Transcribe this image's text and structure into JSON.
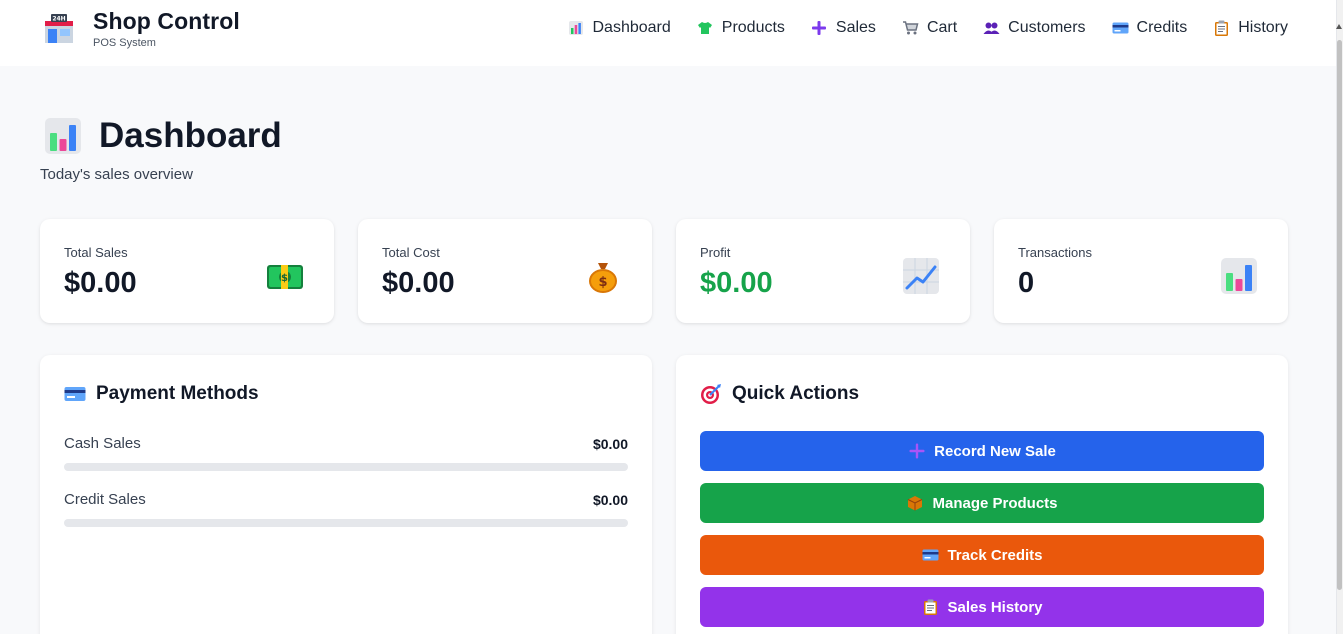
{
  "header": {
    "title": "Shop Control",
    "subtitle": "POS System",
    "logo_icon": "store-24h-icon",
    "nav": [
      {
        "label": "Dashboard",
        "icon": "bar-chart-icon"
      },
      {
        "label": "Products",
        "icon": "shirt-icon"
      },
      {
        "label": "Sales",
        "icon": "plus-icon"
      },
      {
        "label": "Cart",
        "icon": "cart-icon"
      },
      {
        "label": "Customers",
        "icon": "users-icon"
      },
      {
        "label": "Credits",
        "icon": "credit-card-icon"
      },
      {
        "label": "History",
        "icon": "clipboard-icon"
      }
    ]
  },
  "page": {
    "title": "Dashboard",
    "subtitle": "Today's sales overview"
  },
  "stats": [
    {
      "label": "Total Sales",
      "value": "$0.00",
      "icon": "money-bill-icon"
    },
    {
      "label": "Total Cost",
      "value": "$0.00",
      "icon": "money-bag-icon"
    },
    {
      "label": "Profit",
      "value": "$0.00",
      "icon": "trend-up-icon"
    },
    {
      "label": "Transactions",
      "value": "0",
      "icon": "bar-chart-icon"
    }
  ],
  "payment_methods": {
    "title": "Payment Methods",
    "icon": "credit-card-icon",
    "rows": [
      {
        "label": "Cash Sales",
        "value": "$0.00",
        "fraction": 0
      },
      {
        "label": "Credit Sales",
        "value": "$0.00",
        "fraction": 0
      }
    ]
  },
  "quick_actions": {
    "title": "Quick Actions",
    "icon": "target-icon",
    "buttons": [
      {
        "label": "Record New Sale",
        "icon": "plus-icon",
        "color": "#2563eb"
      },
      {
        "label": "Manage Products",
        "icon": "package-icon",
        "color": "#16a34a"
      },
      {
        "label": "Track Credits",
        "icon": "credit-card-icon",
        "color": "#ea580c"
      },
      {
        "label": "Sales History",
        "icon": "clipboard-icon",
        "color": "#9333ea"
      }
    ]
  },
  "colors": {
    "profit": "#16a34a",
    "accent": "#2563eb"
  }
}
